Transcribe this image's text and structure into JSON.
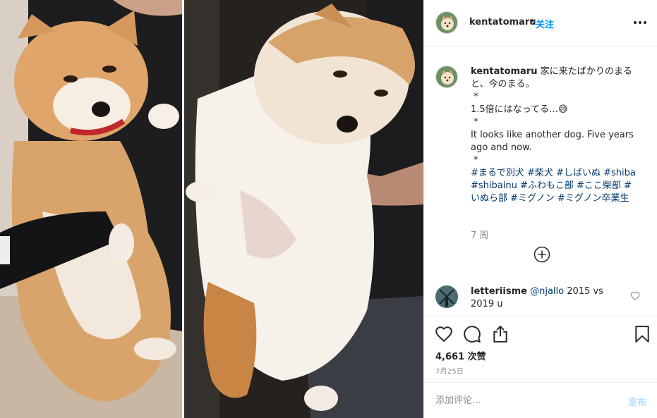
{
  "post": {
    "username": "kentatomaru",
    "separator": "•",
    "follow_label": "关注",
    "more_icon": "more-horizontal-icon"
  },
  "caption": {
    "username": "kentatomaru",
    "lines": [
      "家に来たばかりのまると、今のまる。",
      "*",
      "1.5倍にはなってる…😅",
      "*",
      "It looks like another dog. Five years ago and now.",
      "*"
    ],
    "hashtags": "#まるで別犬 #柴犬 #しばいぬ #shiba #shibainu #ふわもこ部 #ここ柴部 #いぬら部 #ミグノン #ミグノン卒業生",
    "time": "7 周"
  },
  "load_more_icon": "plus-circle-icon",
  "comments": [
    {
      "username": "letteriisme",
      "mention": "@njallo",
      "text": " 2015 vs 2019 u"
    }
  ],
  "actions": {
    "like_icon": "heart-icon",
    "comment_icon": "comment-icon",
    "share_icon": "share-icon",
    "save_icon": "bookmark-icon"
  },
  "likes": "4,661 次赞",
  "date": "7月25日",
  "add_comment": {
    "placeholder": "添加评论...",
    "post_label": "发布"
  },
  "colors": {
    "link": "#0095f6",
    "hashtag": "#00376b",
    "muted": "#8e8e8e",
    "post_disabled": "#b2dffc"
  }
}
